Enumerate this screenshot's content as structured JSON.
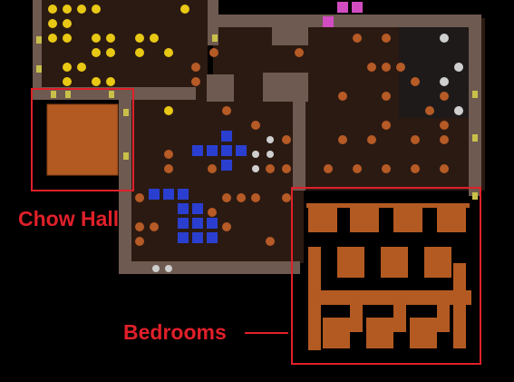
{
  "annotations": {
    "chow_hall_label": "Chow Hall",
    "bedrooms_label": "Bedrooms",
    "highlight_color": "#e0202a"
  },
  "palette": {
    "background": "#000000",
    "rock_floor": "#2b1a12",
    "rough_wall": "#6e5a50",
    "smooth_wall": "#8a6d5f",
    "constructed_floor": "#b35a22",
    "gold_nugget": "#e8c814",
    "copper_ore": "#b65a26",
    "blue_gem": "#2a3fd0",
    "pink_gem": "#d14cc0",
    "door": "#c9c04a"
  },
  "icons": [
    "gold-nugget-icon",
    "ore-boulder-icon",
    "blue-crystal-icon",
    "door-icon",
    "stairway-icon",
    "cage-icon"
  ]
}
